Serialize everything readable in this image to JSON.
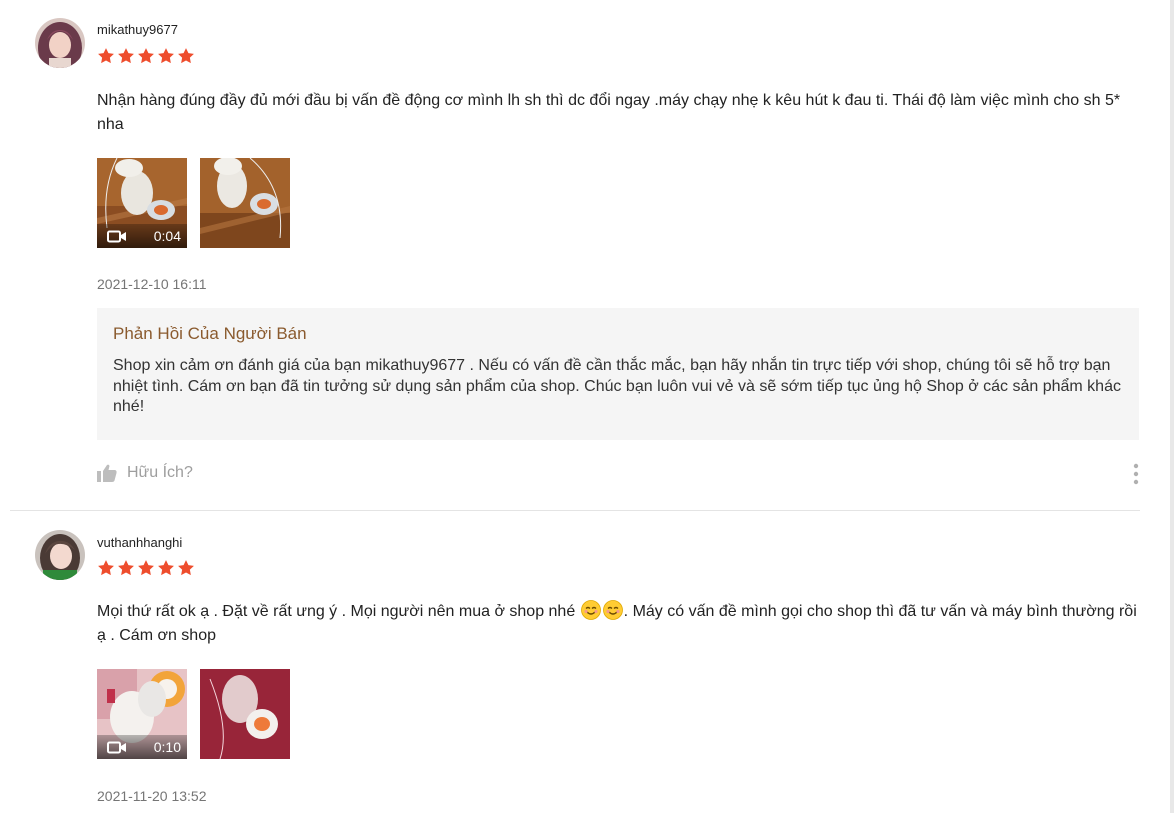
{
  "reviews": [
    {
      "username": "mikathuy9677",
      "rating": 5,
      "comment": "Nhận hàng đúng đầy đủ mới đầu bị vấn đề động cơ mình lh sh thì dc đổi ngay .máy chạy nhẹ k kêu hút k đau ti. Thái độ làm việc mình cho sh 5* nha",
      "video_duration": "0:04",
      "timestamp": "2021-12-10 16:11",
      "seller_reply": {
        "title": "Phản Hồi Của Người Bán",
        "text": "Shop xin cảm ơn đánh giá của bạn  mikathuy9677 . Nếu có vấn đề cần thắc mắc, bạn hãy nhắn tin trực tiếp với shop, chúng tôi sẽ hỗ trợ bạn nhiệt tình. Cám ơn bạn đã tin tưởng sử dụng sản phẩm của shop. Chúc bạn luôn vui vẻ và sẽ sớm tiếp tục ủng hộ Shop ở các sản phẩm khác nhé!"
      },
      "helpful_label": "Hữu Ích?"
    },
    {
      "username": "vuthanhhanghi",
      "rating": 5,
      "comment_part1": "Mọi thứ rất ok ạ . Đặt về rất ưng ý . Mọi người nên mua ở shop nhé ",
      "comment_part2": ". Máy có vấn đề mình gọi cho shop thì đã tư vấn và máy bình thường rồi ạ . Cám ơn shop",
      "video_duration": "0:10",
      "timestamp": "2021-11-20 13:52"
    }
  ],
  "colors": {
    "star": "#ee4d2d",
    "reply_title": "#8a5a2e",
    "reply_bg": "#f5f5f5",
    "muted_text": "#757575"
  },
  "icons": {
    "star": "star-icon",
    "video": "video-camera-icon",
    "helpful": "thumbs-up-icon",
    "more": "more-vertical-icon",
    "emoji": "smiling-face-icon"
  }
}
